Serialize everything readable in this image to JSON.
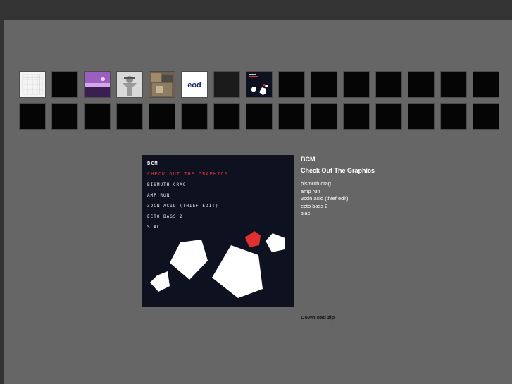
{
  "thumbnails": [
    {
      "art": "grid-white"
    },
    {
      "art": "black"
    },
    {
      "art": "purple-landscape"
    },
    {
      "art": "white-figure"
    },
    {
      "art": "photo-collage"
    },
    {
      "art": "eod-logo"
    },
    {
      "art": "dark-grey"
    },
    {
      "art": "bcm-pentagons"
    },
    {
      "art": "black"
    },
    {
      "art": "black"
    },
    {
      "art": "black"
    },
    {
      "art": "black"
    },
    {
      "art": "black"
    },
    {
      "art": "black"
    },
    {
      "art": "black"
    },
    {
      "art": "black"
    },
    {
      "art": "black"
    },
    {
      "art": "black"
    },
    {
      "art": "black"
    },
    {
      "art": "black"
    },
    {
      "art": "black"
    },
    {
      "art": "black"
    },
    {
      "art": "black"
    },
    {
      "art": "black"
    },
    {
      "art": "black"
    },
    {
      "art": "black"
    },
    {
      "art": "black"
    },
    {
      "art": "black"
    },
    {
      "art": "black"
    },
    {
      "art": "black"
    }
  ],
  "cover": {
    "artist": "BCM",
    "title": "CHECK OUT THE GRAPHICS",
    "tracks": [
      "BISMUTH CRAG",
      "AMP RUN",
      "3DCN ACID (THIEF EDIT)",
      "ECTO BASS 2",
      "SLAC"
    ],
    "colors": {
      "background": "#0e1220",
      "accent": "#e03030",
      "shape": "#ffffff"
    }
  },
  "album": {
    "artist": "BCM",
    "title": "Check Out The Graphics",
    "tracks": [
      "bismuth crag",
      "amp run",
      "3cdn acid (thief edit)",
      "ecto bass 2",
      "slac"
    ],
    "download_label": "Download zip"
  }
}
